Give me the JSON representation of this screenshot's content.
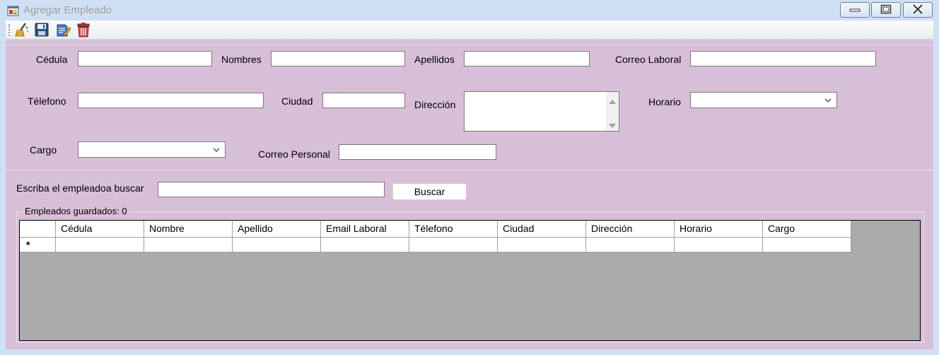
{
  "window": {
    "title": "Agregar Empleado",
    "icon": "app-form-icon"
  },
  "toolbar": {
    "items": [
      {
        "icon": "broom-clear-icon"
      },
      {
        "icon": "floppy-save-icon"
      },
      {
        "icon": "document-edit-icon"
      },
      {
        "icon": "trash-delete-icon"
      }
    ]
  },
  "form": {
    "cedula_label": "Cédula",
    "nombres_label": "Nombres",
    "apellidos_label": "Apellidos",
    "correo_laboral_label": "Correo Laboral",
    "telefono_label": "Télefono",
    "ciudad_label": "Ciudad",
    "direccion_label": "Dirección",
    "horario_label": "Horario",
    "cargo_label": "Cargo",
    "correo_personal_label": "Correo Personal",
    "cedula_value": "",
    "nombres_value": "",
    "apellidos_value": "",
    "correo_laboral_value": "",
    "telefono_value": "",
    "ciudad_value": "",
    "direccion_value": "",
    "horario_value": "",
    "cargo_value": "",
    "correo_personal_value": ""
  },
  "search": {
    "label": "Escriba el empleadoa  buscar",
    "value": "",
    "button_label": "Buscar"
  },
  "grid": {
    "group_title": "Empleados guardados: 0",
    "columns": [
      "Cédula",
      "Nombre",
      "Apellido",
      "Email Laboral",
      "Télefono",
      "Ciudad",
      "Dirección",
      "Horario",
      "Cargo"
    ],
    "new_row_marker": "*"
  },
  "colors": {
    "client_background": "#d8bfd8",
    "window_frame": "#cfe0f5",
    "grid_background": "#ababab"
  }
}
